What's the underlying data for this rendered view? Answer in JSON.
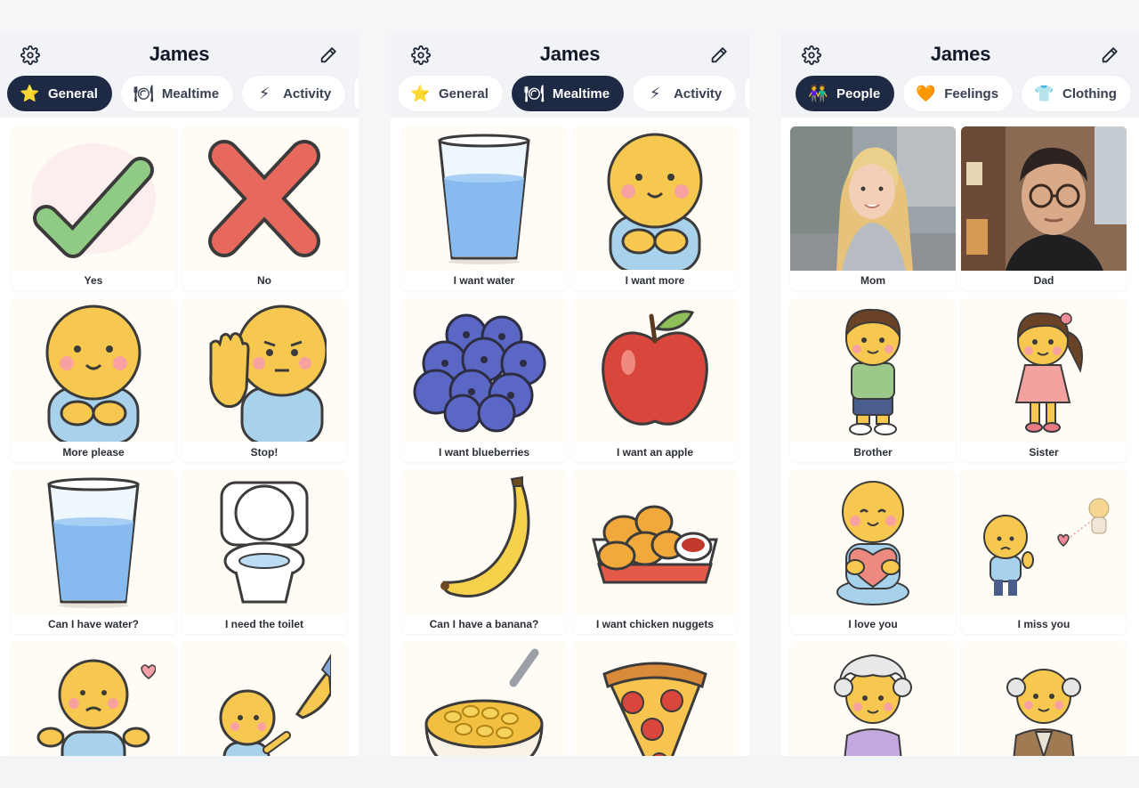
{
  "panels": [
    {
      "title": "James",
      "tabs": [
        {
          "label": "General",
          "icon": "star-icon",
          "glyph": "⭐",
          "active": true
        },
        {
          "label": "Mealtime",
          "icon": "plate-icon",
          "glyph": "🍽",
          "active": false
        },
        {
          "label": "Activity",
          "icon": "lightning-icon",
          "glyph": "⚡",
          "active": false
        }
      ],
      "cards": [
        {
          "label": "Yes",
          "art": "check"
        },
        {
          "label": "No",
          "art": "cross"
        },
        {
          "label": "More please",
          "art": "face-hands"
        },
        {
          "label": "Stop!",
          "art": "face-stop"
        },
        {
          "label": "Can I have water?",
          "art": "water"
        },
        {
          "label": "I need the toilet",
          "art": "toilet"
        },
        {
          "label": "",
          "art": "face-shrug"
        },
        {
          "label": "",
          "art": "face-reach"
        }
      ]
    },
    {
      "title": "James",
      "tabs": [
        {
          "label": "General",
          "icon": "star-icon",
          "glyph": "⭐",
          "active": false
        },
        {
          "label": "Mealtime",
          "icon": "plate-icon",
          "glyph": "🍽",
          "active": true
        },
        {
          "label": "Activity",
          "icon": "lightning-icon",
          "glyph": "⚡",
          "active": false
        }
      ],
      "cards": [
        {
          "label": "I want water",
          "art": "water"
        },
        {
          "label": "I want more",
          "art": "face-hands"
        },
        {
          "label": "I want blueberries",
          "art": "blueberries"
        },
        {
          "label": "I want an apple",
          "art": "apple"
        },
        {
          "label": "Can I have a banana?",
          "art": "banana"
        },
        {
          "label": "I want chicken nuggets",
          "art": "nuggets"
        },
        {
          "label": "",
          "art": "mac"
        },
        {
          "label": "",
          "art": "pizza"
        }
      ]
    },
    {
      "title": "James",
      "tabs": [
        {
          "label": "People",
          "icon": "people-icon",
          "glyph": "👫",
          "active": true
        },
        {
          "label": "Feelings",
          "icon": "heart-icon",
          "glyph": "🧡",
          "active": false
        },
        {
          "label": "Clothing",
          "icon": "shirt-icon",
          "glyph": "👕",
          "active": false
        }
      ],
      "cards": [
        {
          "label": "Mom",
          "art": "photo-mom"
        },
        {
          "label": "Dad",
          "art": "photo-dad"
        },
        {
          "label": "Brother",
          "art": "boy"
        },
        {
          "label": "Sister",
          "art": "girl"
        },
        {
          "label": "I love you",
          "art": "love"
        },
        {
          "label": "I miss you",
          "art": "miss"
        },
        {
          "label": "",
          "art": "grandma"
        },
        {
          "label": "",
          "art": "grandpa"
        }
      ]
    }
  ],
  "colors": {
    "accent": "#1e2a44",
    "header_bg": "#f1f3f7",
    "card_bg": "#fffbf5"
  }
}
